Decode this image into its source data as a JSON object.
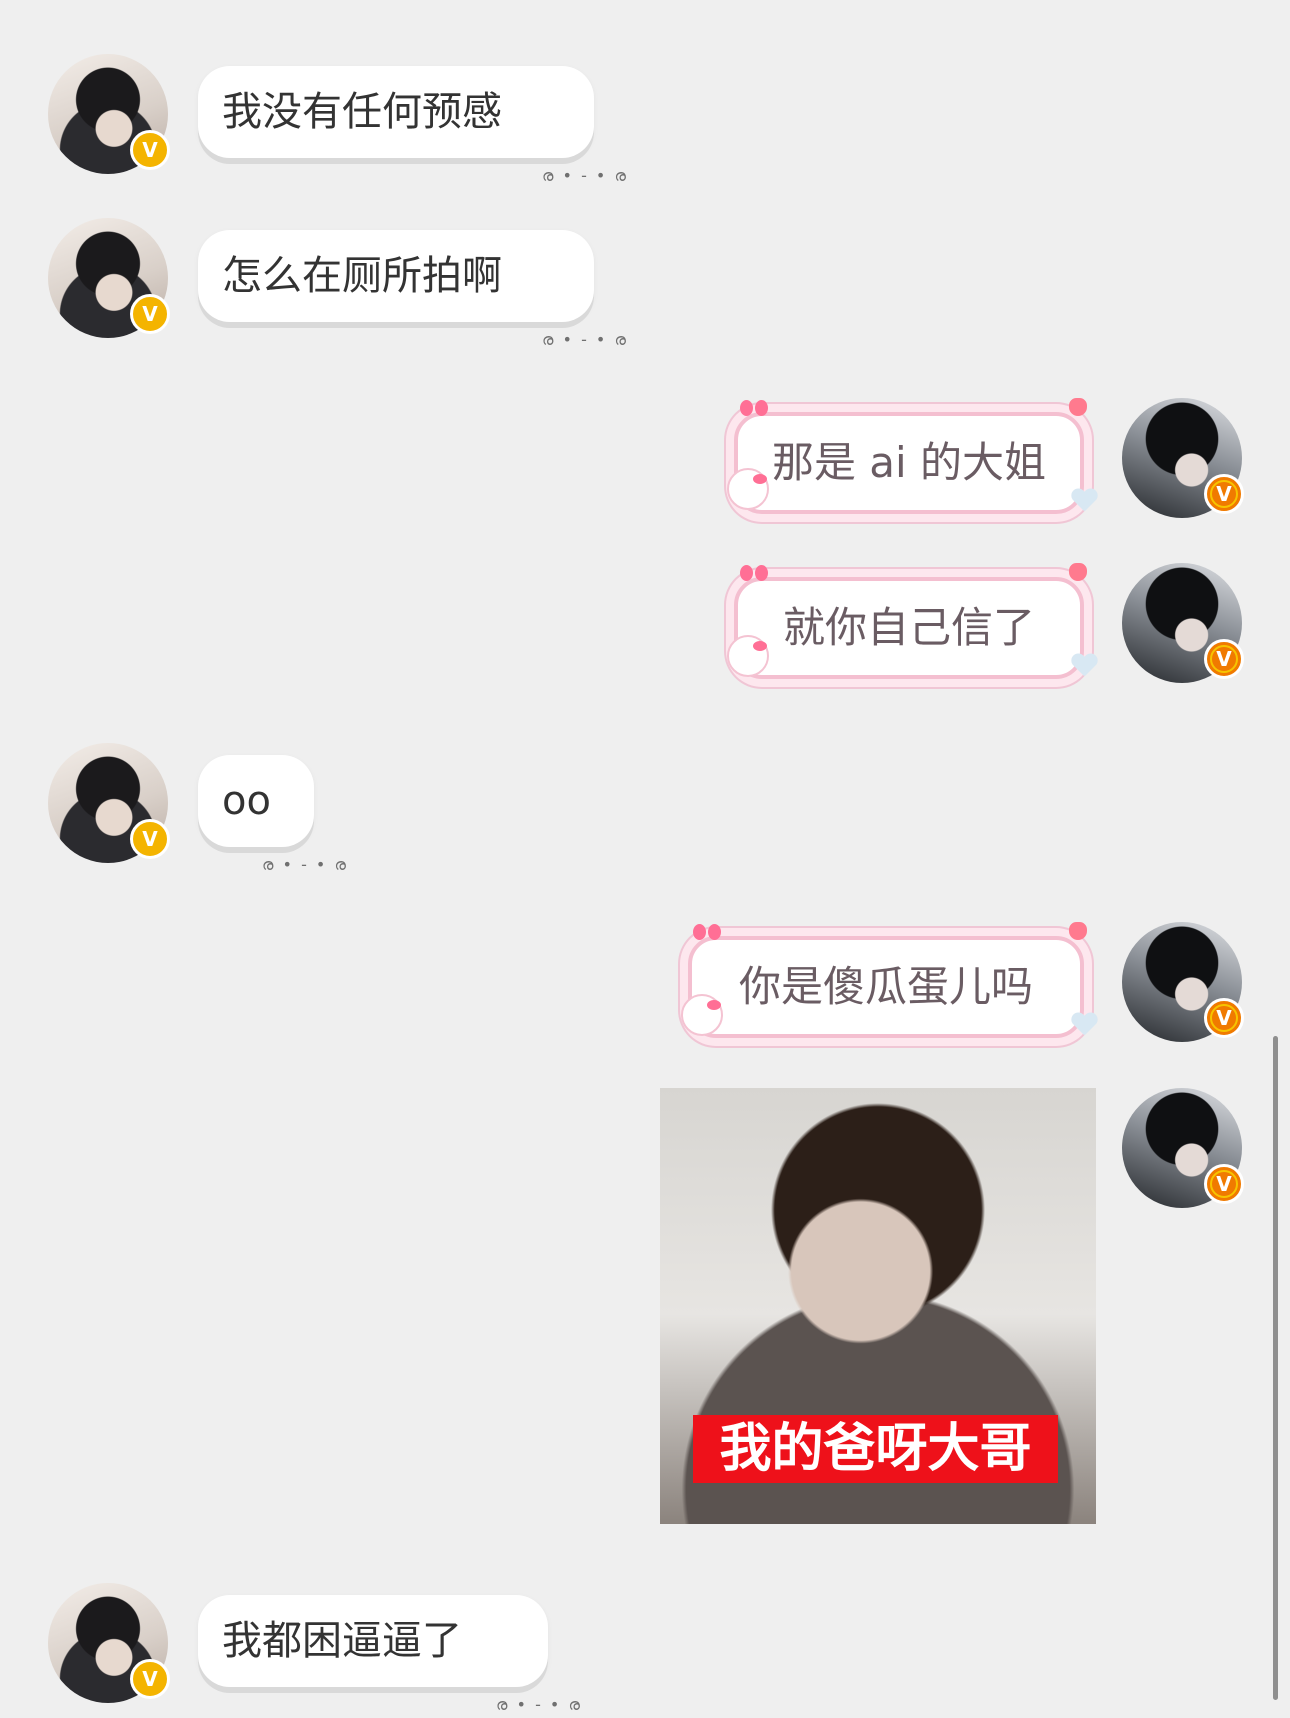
{
  "messages": [
    {
      "side": "left",
      "text": "我没有任何预感",
      "status": "ര • - • ര"
    },
    {
      "side": "left",
      "text": "怎么在厕所拍啊",
      "status": "ര • - • ര"
    },
    {
      "side": "right",
      "text": "那是 ai 的大姐"
    },
    {
      "side": "right",
      "text": "就你自己信了"
    },
    {
      "side": "left",
      "text": "oo",
      "status": "ര • - • ര"
    },
    {
      "side": "right",
      "text": "你是傻瓜蛋儿吗"
    },
    {
      "side": "right",
      "type": "image",
      "caption": "我的爸呀大哥"
    },
    {
      "side": "left",
      "text": "我都困逼逼了",
      "status": "ര • - • ര"
    }
  ],
  "badges": {
    "verified": "V"
  },
  "colors": {
    "background": "#efefef",
    "left_bubble": "#ffffff",
    "right_border": "#f4bfd0",
    "badge_gold": "#f4b400",
    "badge_orange": "#f07a00",
    "caption_red": "#ee111a"
  }
}
